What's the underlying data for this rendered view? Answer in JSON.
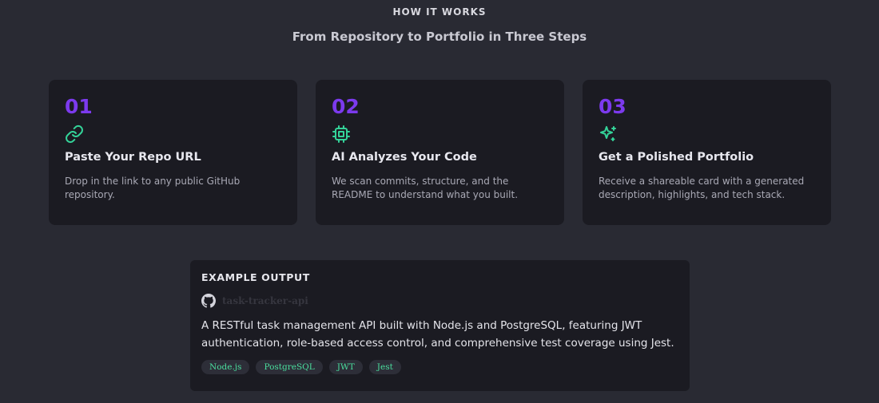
{
  "section": {
    "eyebrow": "HOW IT WORKS",
    "headline": "From Repository to Portfolio in Three Steps"
  },
  "steps": [
    {
      "number": "01",
      "icon": "link-icon",
      "title": "Paste Your Repo URL",
      "description": "Drop in the link to any public GitHub repository."
    },
    {
      "number": "02",
      "icon": "chip-icon",
      "title": "AI Analyzes Your Code",
      "description": "We scan commits, structure, and the README to understand what you built."
    },
    {
      "number": "03",
      "icon": "sparkles-icon",
      "title": "Get a Polished Portfolio",
      "description": "Receive a shareable card with a generated description, highlights, and tech stack."
    }
  ],
  "example": {
    "label": "EXAMPLE OUTPUT",
    "repo_icon": "github-icon",
    "repo_name": "task-tracker-api",
    "description": "A RESTful task management API built with Node.js and PostgreSQL, featuring JWT authentication, role-based access control, and comprehensive test coverage using Jest.",
    "tags": [
      "Node.js",
      "PostgreSQL",
      "JWT",
      "Jest"
    ]
  },
  "colors": {
    "background": "#292a33",
    "card": "#1b1b22",
    "step_number": "#7c3aed",
    "icon_accent": "#34d399",
    "tag_text": "#4ade9e"
  }
}
